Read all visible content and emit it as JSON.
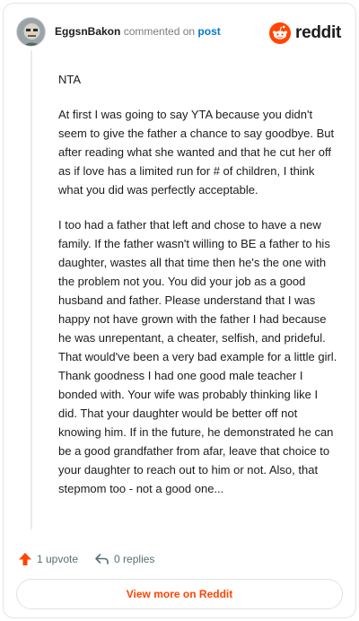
{
  "header": {
    "username": "EggsnBakon",
    "verb": "commented on",
    "post_link": "post",
    "brand": "reddit"
  },
  "comment": {
    "paragraphs": [
      "NTA",
      "At first I was going to say YTA because you didn't seem to give the father a chance to say goodbye. But after reading what she wanted and that he cut her off as if love has a limited run for # of children, I think what you did was perfectly acceptable.",
      "I too had a father that left and chose to have a new family. If the father wasn't willing to BE a father to his daughter, wastes all that time then he's the one with the problem not you. You did your job as a good husband and father. Please understand that I was happy not have grown with the father I had because he was unrepentant, a cheater, selfish, and prideful. That would've been a very bad example for a little girl. Thank goodness I had one good male teacher I bonded with. Your wife was probably thinking like I did. That your daughter would be better off not knowing him. If in the future, he demonstrated he can be a good grandfather from afar, leave that choice to your daughter to reach out to him or not. Also, that stepmom too - not a good one..."
    ]
  },
  "actions": {
    "upvotes": "1 upvote",
    "replies": "0 replies"
  },
  "footer": {
    "view_more": "View more on Reddit"
  },
  "colors": {
    "accent": "#ff4500",
    "link": "#0079d3",
    "muted": "#576f76"
  }
}
